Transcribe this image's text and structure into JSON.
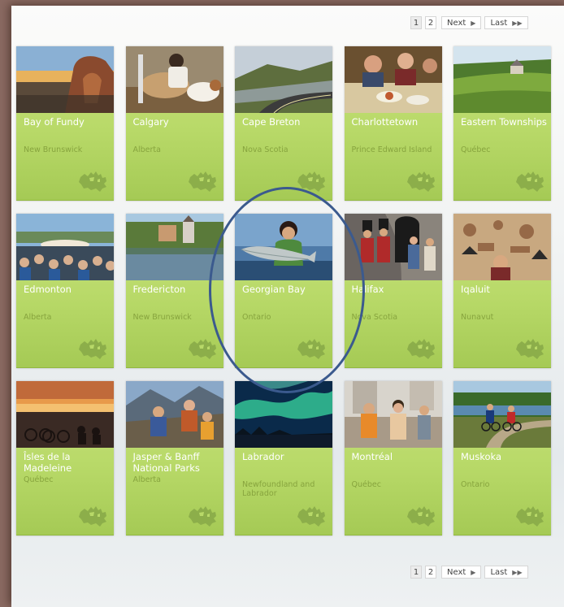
{
  "pagination": {
    "pages": [
      "1",
      "2"
    ],
    "current": "1",
    "next_label": "Next",
    "last_label": "Last",
    "next_icon": "play-arrow-icon",
    "last_icon": "double-arrow-icon"
  },
  "destinations": [
    {
      "city": "Bay of Fundy",
      "province": "New Brunswick",
      "photo": "rock-coast"
    },
    {
      "city": "Calgary",
      "province": "Alberta",
      "photo": "rodeo"
    },
    {
      "city": "Cape Breton",
      "province": "Nova Scotia",
      "photo": "coastal-road"
    },
    {
      "city": "Charlottetown",
      "province": "Prince Edward Island",
      "photo": "dining"
    },
    {
      "city": "Eastern Townships",
      "province": "Québec",
      "photo": "green-valley"
    },
    {
      "city": "Edmonton",
      "province": "Alberta",
      "photo": "festival-crowd"
    },
    {
      "city": "Fredericton",
      "province": "New Brunswick",
      "photo": "river-town"
    },
    {
      "city": "Georgian Bay",
      "province": "Ontario",
      "photo": "fishing"
    },
    {
      "city": "Halifax",
      "province": "Nova Scotia",
      "photo": "soldiers"
    },
    {
      "city": "Iqaluit",
      "province": "Nunavut",
      "photo": "art-wall"
    },
    {
      "city": "Îsles de la Madeleine",
      "province": "Québec",
      "photo": "sunset-bikes"
    },
    {
      "city": "Jasper & Banff National Parks",
      "province": "Alberta",
      "photo": "hikers"
    },
    {
      "city": "Labrador",
      "province": "Newfoundland and Labrador",
      "photo": "aurora"
    },
    {
      "city": "Montréal",
      "province": "Québec",
      "photo": "street-crowd"
    },
    {
      "city": "Muskoka",
      "province": "Ontario",
      "photo": "cyclists"
    }
  ],
  "map_icon": "canada-map-icon",
  "colors": {
    "tile": "#b8d968",
    "city_text": "#ffffff",
    "province_text": "#87a43e",
    "highlight": "#3b5a8e"
  }
}
